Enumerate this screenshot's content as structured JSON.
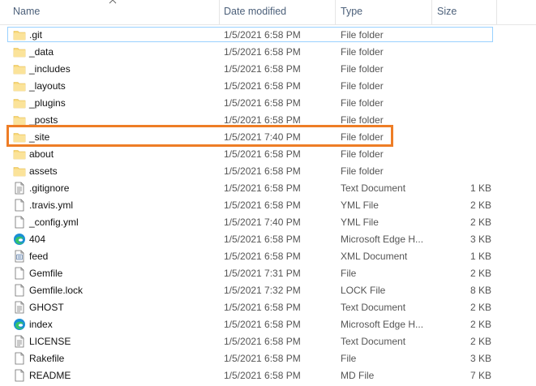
{
  "columns": {
    "name": "Name",
    "date": "Date modified",
    "type": "Type",
    "size": "Size"
  },
  "files": [
    {
      "name": ".git",
      "date": "1/5/2021 6:58 PM",
      "type": "File folder",
      "size": "",
      "icon": "folder-icon"
    },
    {
      "name": "_data",
      "date": "1/5/2021 6:58 PM",
      "type": "File folder",
      "size": "",
      "icon": "folder-icon"
    },
    {
      "name": "_includes",
      "date": "1/5/2021 6:58 PM",
      "type": "File folder",
      "size": "",
      "icon": "folder-icon"
    },
    {
      "name": "_layouts",
      "date": "1/5/2021 6:58 PM",
      "type": "File folder",
      "size": "",
      "icon": "folder-icon"
    },
    {
      "name": "_plugins",
      "date": "1/5/2021 6:58 PM",
      "type": "File folder",
      "size": "",
      "icon": "folder-icon"
    },
    {
      "name": "_posts",
      "date": "1/5/2021 6:58 PM",
      "type": "File folder",
      "size": "",
      "icon": "folder-icon"
    },
    {
      "name": "_site",
      "date": "1/5/2021 7:40 PM",
      "type": "File folder",
      "size": "",
      "icon": "folder-icon"
    },
    {
      "name": "about",
      "date": "1/5/2021 6:58 PM",
      "type": "File folder",
      "size": "",
      "icon": "folder-icon"
    },
    {
      "name": "assets",
      "date": "1/5/2021 6:58 PM",
      "type": "File folder",
      "size": "",
      "icon": "folder-icon"
    },
    {
      "name": ".gitignore",
      "date": "1/5/2021 6:58 PM",
      "type": "Text Document",
      "size": "1 KB",
      "icon": "text-file-icon"
    },
    {
      "name": ".travis.yml",
      "date": "1/5/2021 6:58 PM",
      "type": "YML File",
      "size": "2 KB",
      "icon": "file-icon"
    },
    {
      "name": "_config.yml",
      "date": "1/5/2021 7:40 PM",
      "type": "YML File",
      "size": "2 KB",
      "icon": "file-icon"
    },
    {
      "name": "404",
      "date": "1/5/2021 6:58 PM",
      "type": "Microsoft Edge H...",
      "size": "3 KB",
      "icon": "edge-icon"
    },
    {
      "name": "feed",
      "date": "1/5/2021 6:58 PM",
      "type": "XML Document",
      "size": "1 KB",
      "icon": "xml-file-icon"
    },
    {
      "name": "Gemfile",
      "date": "1/5/2021 7:31 PM",
      "type": "File",
      "size": "2 KB",
      "icon": "file-icon"
    },
    {
      "name": "Gemfile.lock",
      "date": "1/5/2021 7:32 PM",
      "type": "LOCK File",
      "size": "8 KB",
      "icon": "file-icon"
    },
    {
      "name": "GHOST",
      "date": "1/5/2021 6:58 PM",
      "type": "Text Document",
      "size": "2 KB",
      "icon": "text-file-icon"
    },
    {
      "name": "index",
      "date": "1/5/2021 6:58 PM",
      "type": "Microsoft Edge H...",
      "size": "2 KB",
      "icon": "edge-icon"
    },
    {
      "name": "LICENSE",
      "date": "1/5/2021 6:58 PM",
      "type": "Text Document",
      "size": "2 KB",
      "icon": "text-file-icon"
    },
    {
      "name": "Rakefile",
      "date": "1/5/2021 6:58 PM",
      "type": "File",
      "size": "3 KB",
      "icon": "file-icon"
    },
    {
      "name": "README",
      "date": "1/5/2021 6:58 PM",
      "type": "MD File",
      "size": "7 KB",
      "icon": "file-icon"
    }
  ],
  "colors": {
    "highlight": "#ee7d26",
    "folder": "#f8d775",
    "focus": "#99d1ff"
  }
}
